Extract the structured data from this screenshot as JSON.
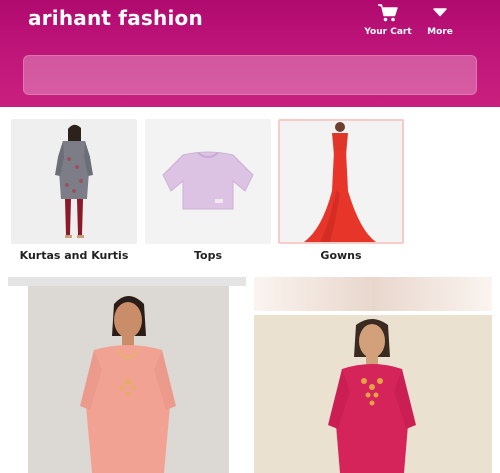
{
  "header": {
    "brand": "arihant fashion",
    "cart_label": "Your Cart",
    "more_label": "More",
    "icons": {
      "cart": "cart-icon",
      "more": "chevron-down-icon"
    },
    "colors": {
      "brand_bg": "#b00a6e",
      "text": "#ffffff"
    }
  },
  "search": {
    "placeholder": ""
  },
  "categories": [
    {
      "label": "Kurtas and Kurtis",
      "selected": false
    },
    {
      "label": "Tops",
      "selected": false
    },
    {
      "label": "Gowns",
      "selected": true
    }
  ]
}
